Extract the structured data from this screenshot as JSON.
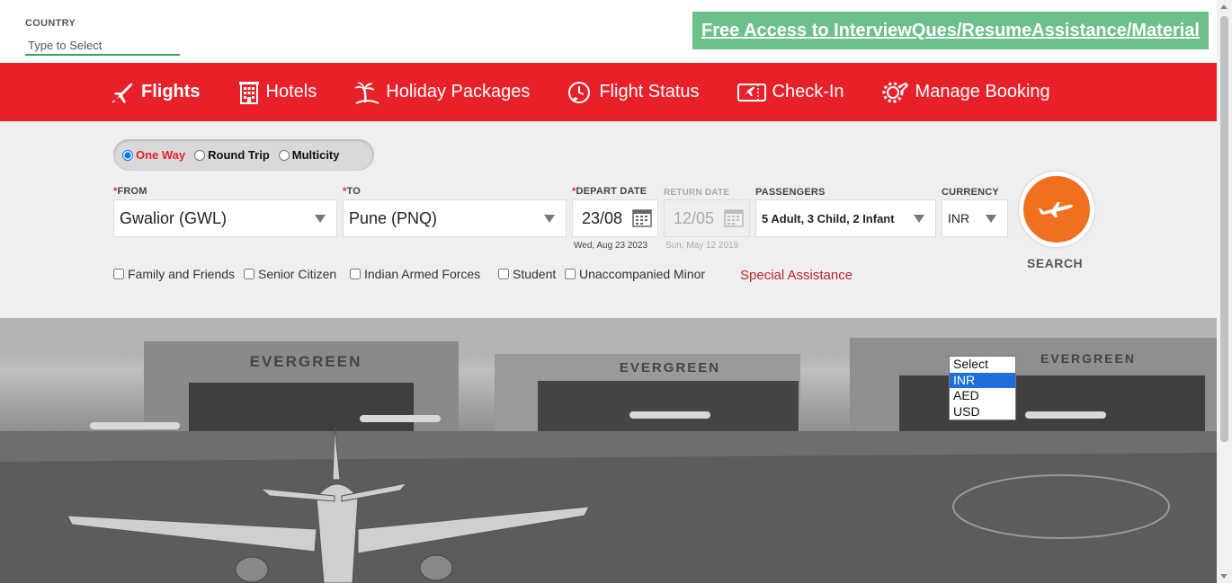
{
  "country": {
    "label": "COUNTRY",
    "placeholder": "Type to Select"
  },
  "promo": {
    "text": "Free Access to InterviewQues/ResumeAssistance/Material"
  },
  "nav": {
    "flights": "Flights",
    "hotels": "Hotels",
    "holiday": "Holiday Packages",
    "status": "Flight Status",
    "checkin": "Check-In",
    "manage": "Manage Booking"
  },
  "trip": {
    "one_way": "One Way",
    "round_trip": "Round Trip",
    "multicity": "Multicity",
    "selected": "One Way"
  },
  "from": {
    "label": "FROM",
    "value": "Gwalior (GWL)"
  },
  "to": {
    "label": "TO",
    "value": "Pune (PNQ)"
  },
  "depart": {
    "label": "DEPART DATE",
    "value": "23/08",
    "sub": "Wed, Aug 23 2023"
  },
  "return": {
    "label": "RETURN DATE",
    "value": "12/05",
    "sub": "Sun, May 12 2019"
  },
  "passengers": {
    "label": "PASSENGERS",
    "value": "5 Adult, 3 Child, 2 Infant"
  },
  "currency": {
    "label": "CURRENCY",
    "value": "INR",
    "options": [
      "Select",
      "INR",
      "AED",
      "USD"
    ],
    "highlighted": "INR"
  },
  "checkboxes": {
    "family": "Family and Friends",
    "senior": "Senior Citizen",
    "armed": "Indian Armed Forces",
    "student": "Student",
    "minor": "Unaccompanied Minor"
  },
  "special_assistance": "Special Assistance",
  "search": {
    "label": "SEARCH"
  },
  "hero": {
    "sign1": "EVERGREEN",
    "sign2": "EVERGREEN",
    "sign3": "EVERGREEN"
  },
  "colors": {
    "brand_red": "#e8202a",
    "search_orange": "#f07020",
    "promo_green": "#6cc08b",
    "dropdown_highlight": "#1e6fd9"
  }
}
